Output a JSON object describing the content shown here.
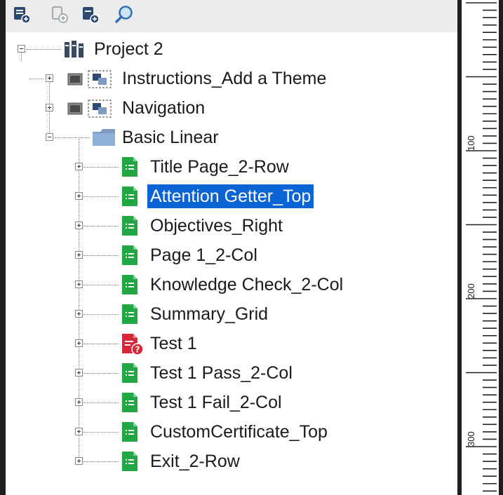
{
  "toolbar": {
    "buttons": [
      {
        "name": "add-page-icon"
      },
      {
        "name": "add-section-icon"
      },
      {
        "name": "add-copy-icon"
      },
      {
        "name": "search-icon"
      }
    ]
  },
  "tree": {
    "project": {
      "label": "Project 2",
      "icon": "project-icon"
    },
    "chapters": [
      {
        "label": "Instructions_Add a Theme",
        "icon": "chapter-icon"
      },
      {
        "label": "Navigation",
        "icon": "chapter-icon"
      },
      {
        "label": "Basic Linear",
        "icon": "folder-icon"
      }
    ],
    "pages": [
      {
        "label": "Title Page_2-Row",
        "icon": "page-icon"
      },
      {
        "label": "Attention Getter_Top",
        "icon": "page-icon",
        "selected": true
      },
      {
        "label": "Objectives_Right",
        "icon": "page-icon"
      },
      {
        "label": "Page 1_2-Col",
        "icon": "page-icon"
      },
      {
        "label": "Knowledge Check_2-Col",
        "icon": "page-icon"
      },
      {
        "label": "Summary_Grid",
        "icon": "page-icon"
      },
      {
        "label": "Test 1",
        "icon": "test-icon"
      },
      {
        "label": "Test 1 Pass_2-Col",
        "icon": "page-icon"
      },
      {
        "label": "Test 1 Fail_2-Col",
        "icon": "page-icon"
      },
      {
        "label": "CustomCertificate_Top",
        "icon": "page-icon"
      },
      {
        "label": "Exit_2-Row",
        "icon": "page-icon"
      }
    ]
  },
  "ruler": {
    "labels": [
      "100",
      "200",
      "300"
    ]
  },
  "colors": {
    "selection": "#0a64d6",
    "page_green": "#21a845",
    "test_red": "#d6283a",
    "folder_blue": "#7c9cc4"
  }
}
